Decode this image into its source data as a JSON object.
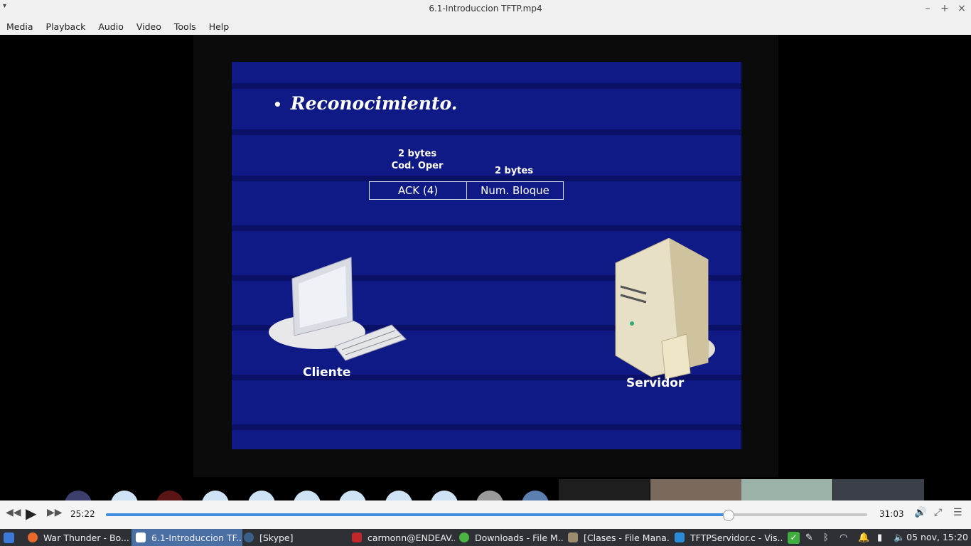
{
  "window": {
    "title": "6.1-Introduccion TFTP.mp4"
  },
  "menu": [
    "Media",
    "Playback",
    "Audio",
    "Video",
    "Tools",
    "Help"
  ],
  "slide": {
    "bullet": "Reconocimiento.",
    "field1_size": "2 bytes",
    "field1_name": "Cod. Oper",
    "field2_size": "2 bytes",
    "cell1": "ACK (4)",
    "cell2": "Num. Bloque",
    "client_label": "Cliente",
    "server_label": "Servidor",
    "background_color": "#0f1a86"
  },
  "player": {
    "elapsed": "25:22",
    "total": "31:03",
    "progress_fraction": 0.817,
    "accent": "#3d8ee0",
    "buttons": [
      "rewind-icon",
      "play-icon",
      "fast-forward-icon",
      "volume-icon",
      "fullscreen-icon",
      "playlist-icon"
    ]
  },
  "taskbar": {
    "tasks": [
      {
        "label": "War Thunder - Bo...",
        "icon": "firefox-icon"
      },
      {
        "label": "6.1-Introduccion TF...",
        "icon": "media-player-icon",
        "active": true
      },
      {
        "label": "[Skype]",
        "icon": "skype-icon"
      },
      {
        "label": "carmonn@ENDEAV...",
        "icon": "terminal-icon"
      },
      {
        "label": "Downloads - File M...",
        "icon": "download-icon"
      },
      {
        "label": "[Clases - File Mana...",
        "icon": "folder-icon"
      },
      {
        "label": "TFTPServidor.c - Vis...",
        "icon": "vscode-icon"
      }
    ],
    "clock": "05 nov, 15:20"
  }
}
